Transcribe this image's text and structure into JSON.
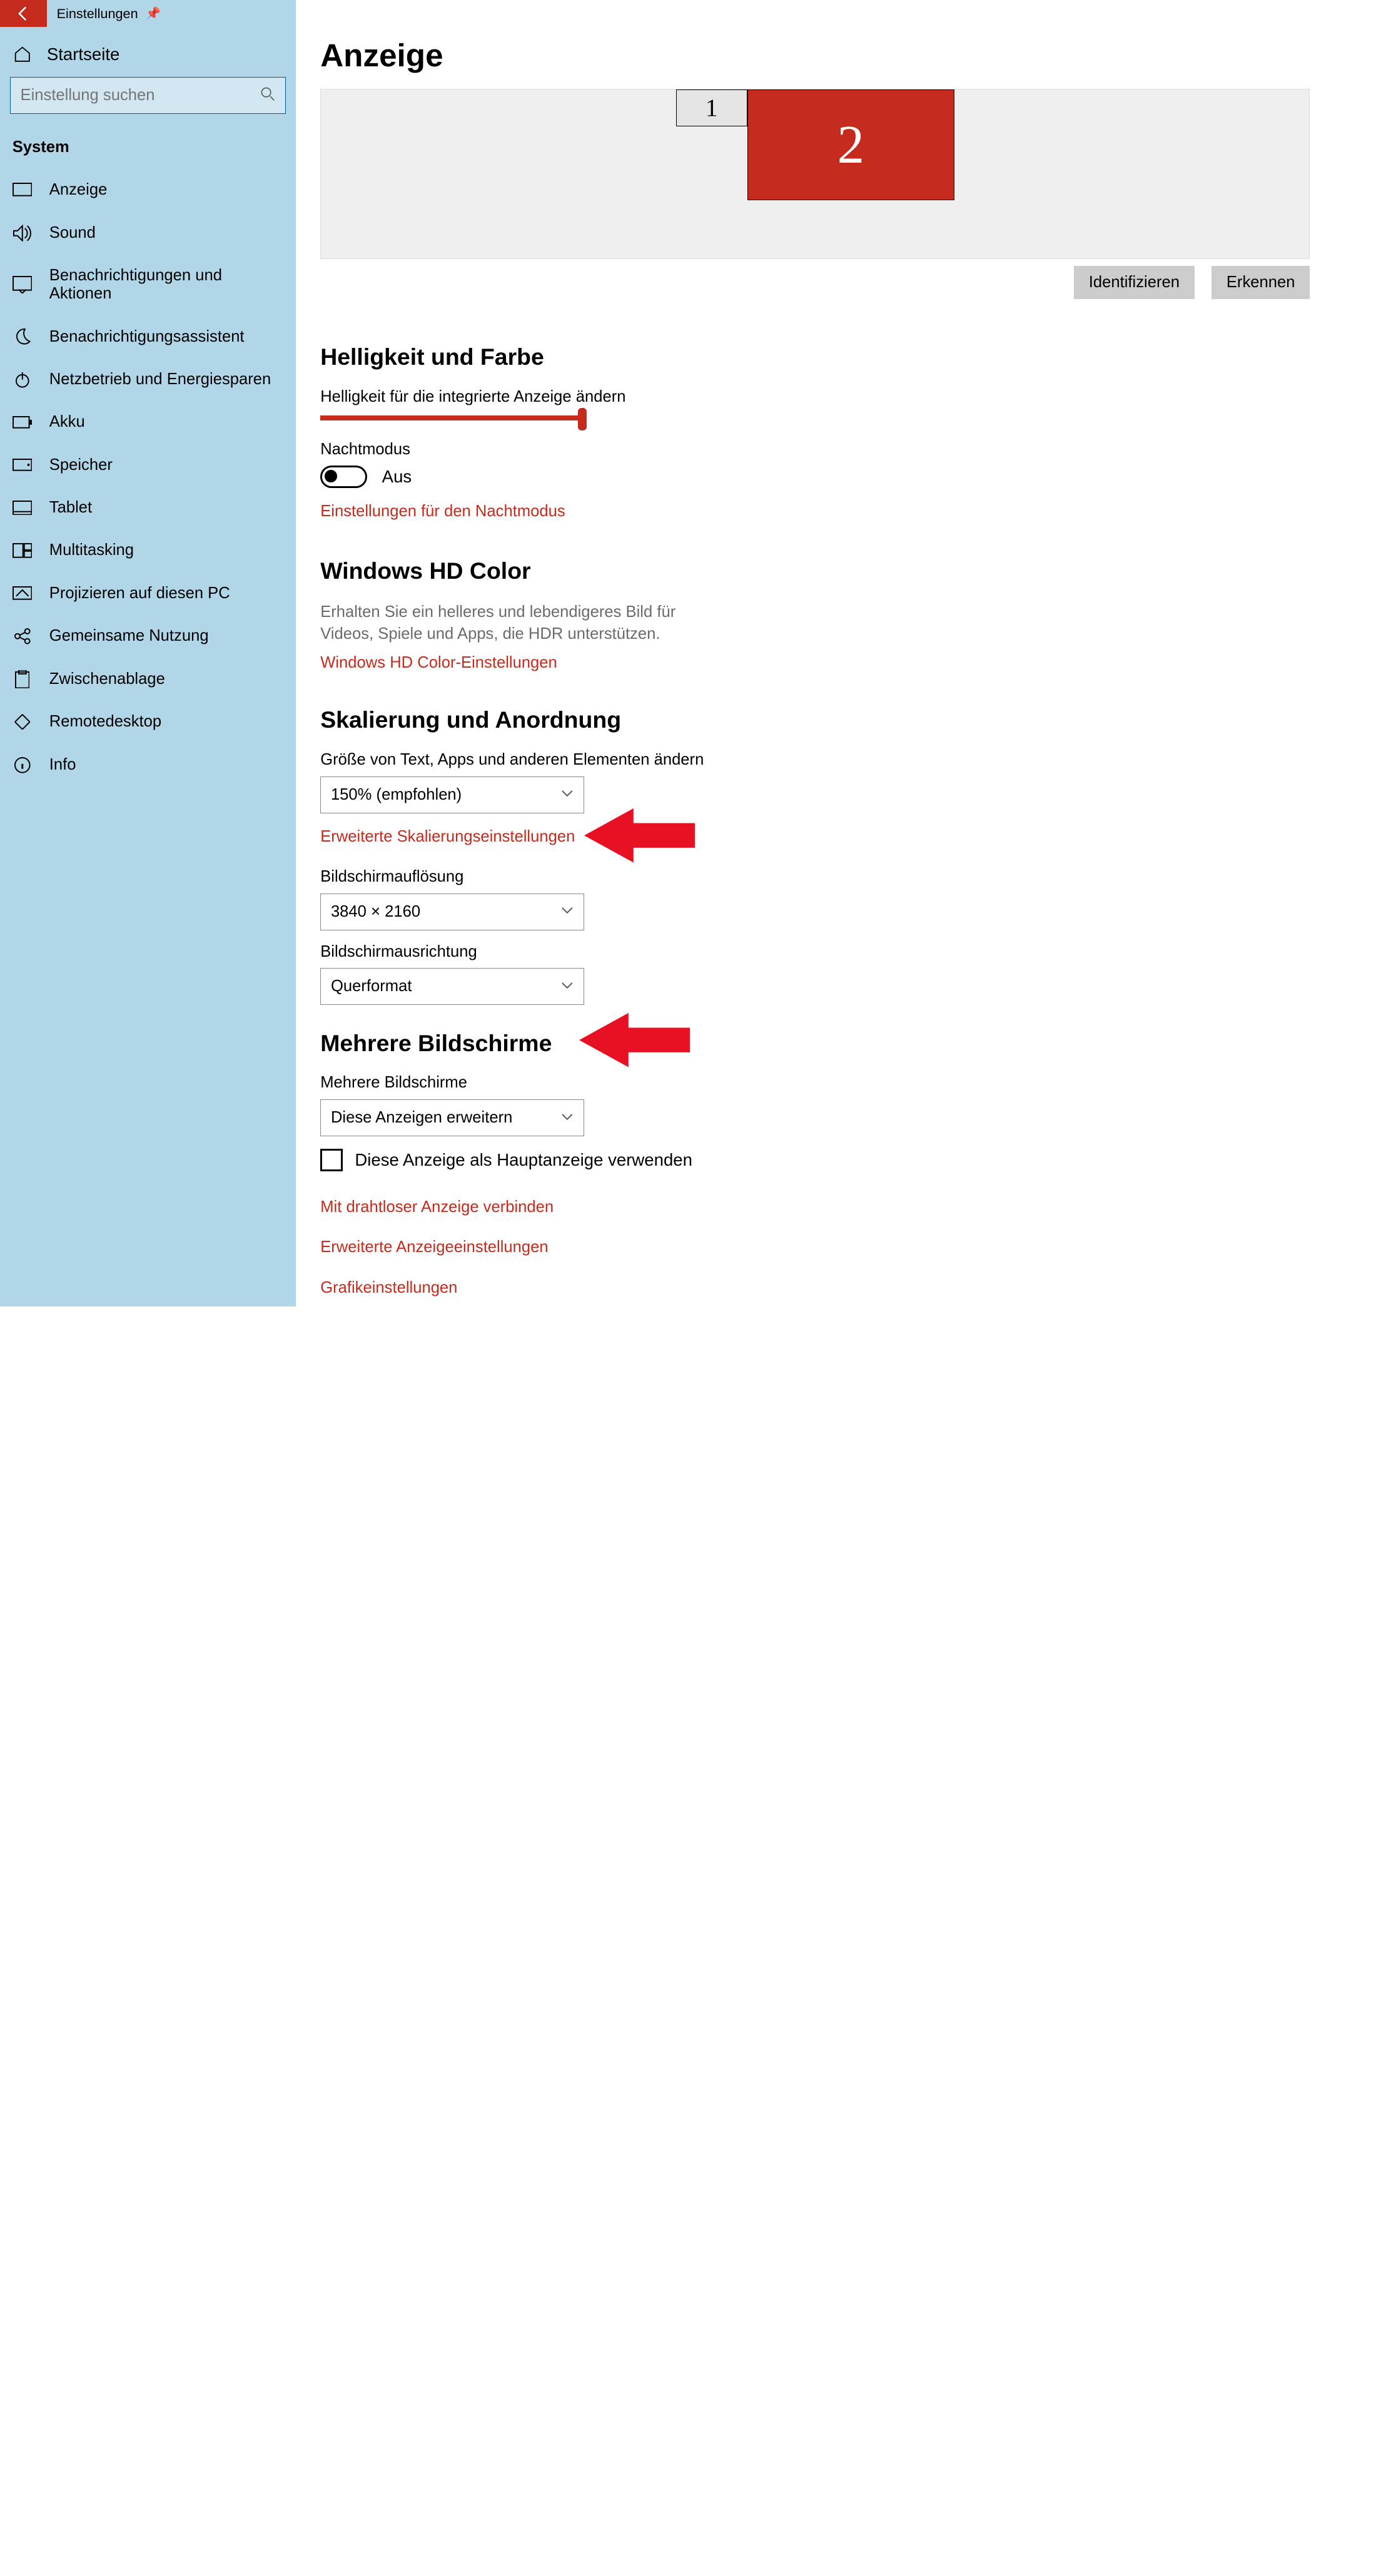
{
  "titlebar": {
    "app": "Einstellungen"
  },
  "sidebar": {
    "home": "Startseite",
    "search_placeholder": "Einstellung suchen",
    "section": "System",
    "items": [
      "Anzeige",
      "Sound",
      "Benachrichtigungen und Aktionen",
      "Benachrichtigungsassistent",
      "Netzbetrieb und Energiesparen",
      "Akku",
      "Speicher",
      "Tablet",
      "Multitasking",
      "Projizieren auf diesen PC",
      "Gemeinsame Nutzung",
      "Zwischenablage",
      "Remotedesktop",
      "Info"
    ]
  },
  "page": {
    "title": "Anzeige",
    "monitors": {
      "one": "1",
      "two": "2"
    },
    "identify": "Identifizieren",
    "detect": "Erkennen",
    "brightness": {
      "heading": "Helligkeit und Farbe",
      "slider_label": "Helligkeit für die integrierte Anzeige ändern",
      "night_label": "Nachtmodus",
      "night_state": "Aus",
      "night_link": "Einstellungen für den Nachtmodus"
    },
    "hd": {
      "heading": "Windows HD Color",
      "desc": "Erhalten Sie ein helleres und lebendigeres Bild für Videos, Spiele und Apps, die HDR unterstützen.",
      "link": "Windows HD Color-Einstellungen"
    },
    "scale": {
      "heading": "Skalierung und Anordnung",
      "size_label": "Größe von Text, Apps und anderen Elementen ändern",
      "size_value": "150% (empfohlen)",
      "advanced_link": "Erweiterte Skalierungseinstellungen",
      "res_label": "Bildschirmauflösung",
      "res_value": "3840 × 2160",
      "orient_label": "Bildschirmausrichtung",
      "orient_value": "Querformat"
    },
    "multi": {
      "heading": "Mehrere Bildschirme",
      "label": "Mehrere Bildschirme",
      "value": "Diese Anzeigen erweitern",
      "check_label": "Diese Anzeige als Hauptanzeige verwenden",
      "links": [
        "Mit drahtloser Anzeige verbinden",
        "Erweiterte Anzeigeeinstellungen",
        "Grafikeinstellungen"
      ]
    }
  }
}
